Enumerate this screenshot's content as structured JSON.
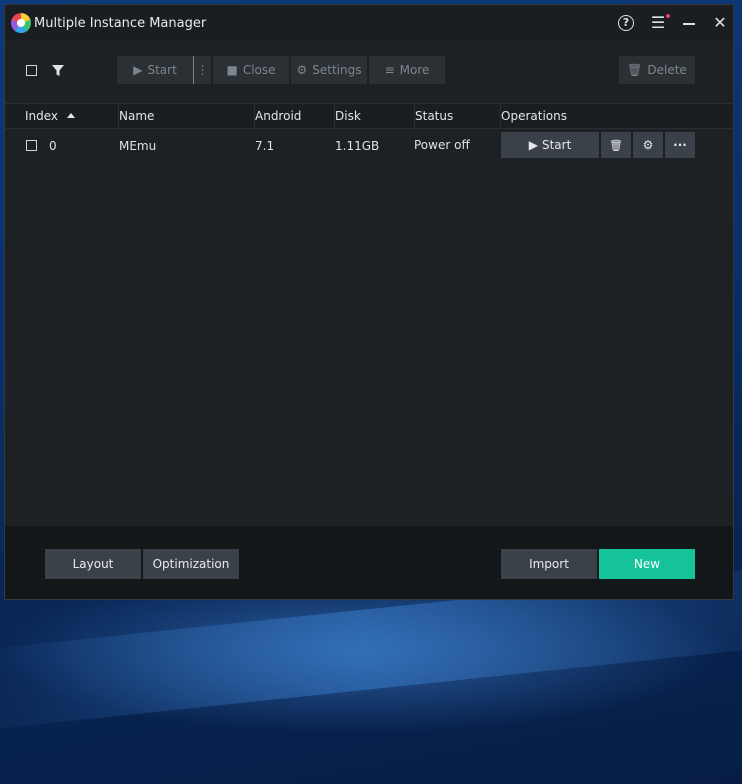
{
  "window": {
    "title": "Multiple Instance Manager"
  },
  "toolbar": {
    "start_label": "Start",
    "close_label": "Close",
    "settings_label": "Settings",
    "more_label": "More",
    "delete_label": "Delete"
  },
  "table": {
    "headers": {
      "index": "Index",
      "name": "Name",
      "android": "Android",
      "disk": "Disk",
      "status": "Status",
      "operations": "Operations"
    },
    "rows": [
      {
        "index": "0",
        "name": "MEmu",
        "android": "7.1",
        "disk": "1.11GB",
        "status": "Power off",
        "start_label": "Start"
      }
    ]
  },
  "footer": {
    "layout_label": "Layout",
    "optimization_label": "Optimization",
    "import_label": "Import",
    "new_label": "New"
  },
  "colors": {
    "accent": "#15c39a",
    "window_bg": "#1e2124",
    "footer_bg": "#14171a",
    "button_bg": "#3a4148",
    "notification_dot": "#e0435a"
  },
  "icons": [
    "app-logo-icon",
    "help-icon",
    "menu-icon",
    "minimize-icon",
    "close-icon",
    "filter-icon",
    "play-icon",
    "stop-icon",
    "gear-icon",
    "list-icon",
    "trash-icon",
    "kebab-icon",
    "sort-ascending-icon"
  ]
}
